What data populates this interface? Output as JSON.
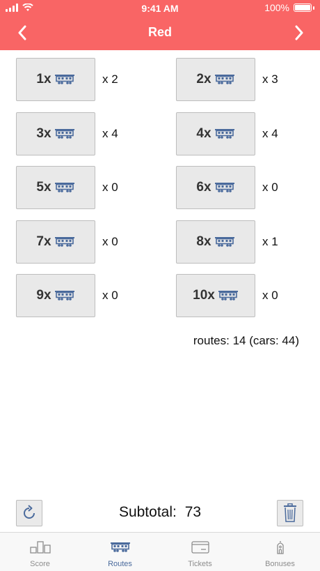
{
  "status": {
    "time": "9:41 AM",
    "battery": "100%"
  },
  "header": {
    "title": "Red",
    "prev_icon": "chevron-left-icon",
    "next_icon": "chevron-right-icon"
  },
  "routes": [
    {
      "label": "1x",
      "count": "x 2"
    },
    {
      "label": "2x",
      "count": "x 3"
    },
    {
      "label": "3x",
      "count": "x 4"
    },
    {
      "label": "4x",
      "count": "x 4"
    },
    {
      "label": "5x",
      "count": "x 0"
    },
    {
      "label": "6x",
      "count": "x 0"
    },
    {
      "label": "7x",
      "count": "x 0"
    },
    {
      "label": "8x",
      "count": "x 1"
    },
    {
      "label": "9x",
      "count": "x 0"
    },
    {
      "label": "10x",
      "count": "x 0"
    }
  ],
  "summary": "routes: 14 (cars: 44)",
  "subtotal": {
    "label": "Subtotal:",
    "value": "73"
  },
  "tabs": [
    {
      "label": "Score",
      "icon": "bar-chart-icon"
    },
    {
      "label": "Routes",
      "icon": "train-car-icon"
    },
    {
      "label": "Tickets",
      "icon": "ticket-icon"
    },
    {
      "label": "Bonuses",
      "icon": "bell-tower-icon"
    }
  ],
  "colors": {
    "header": "#f96565",
    "accent": "#4a6a9c"
  }
}
